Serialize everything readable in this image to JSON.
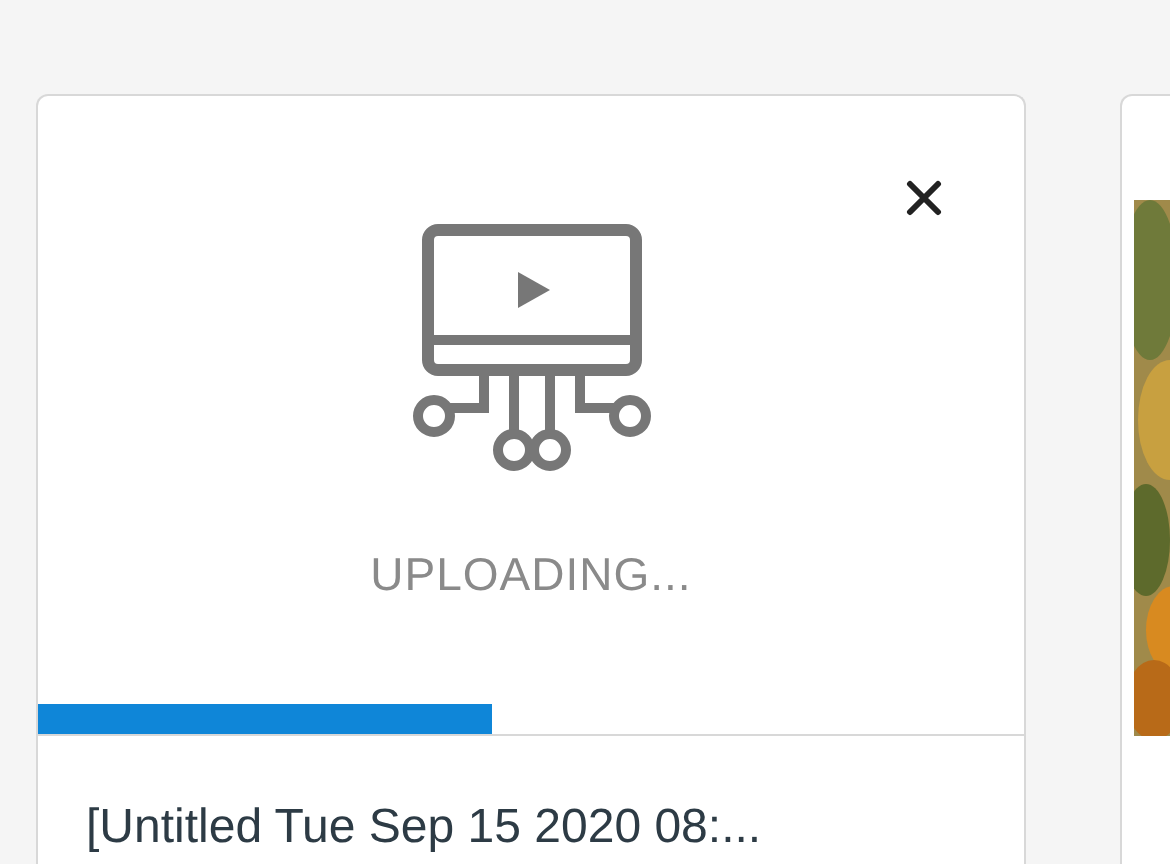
{
  "cards": [
    {
      "kind": "upload",
      "status": "UPLOADING...",
      "level": 0.46,
      "title": "[Untitled Tue Sep 15 2020 08:..."
    },
    {
      "kind": "picture"
    }
  ]
}
